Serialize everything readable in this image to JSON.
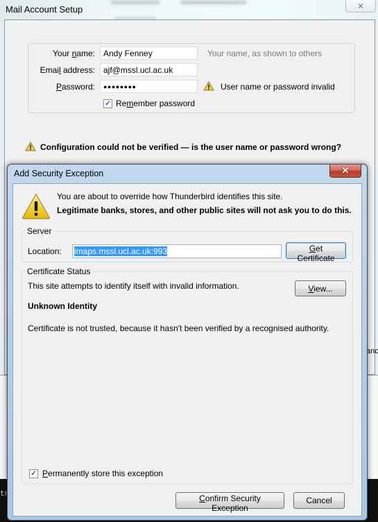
{
  "background": {
    "right_fragment_text": "anc",
    "terminal_fragment_text": "tn"
  },
  "mail_setup": {
    "window_title": "Mail Account Setup",
    "close_glyph": "✕",
    "fields": {
      "name": {
        "label_pre": "Your ",
        "label_accel": "n",
        "label_post": "ame:",
        "value": "Andy Fenney",
        "hint": "Your name, as shown to others"
      },
      "email": {
        "label_pre": "Emai",
        "label_accel": "l",
        "label_post": " address:",
        "value": "ajf@mssl.ucl.ac.uk"
      },
      "password": {
        "label_pre": "",
        "label_accel": "P",
        "label_post": "assword:",
        "value": "●●●●●●●●",
        "error": "User name or password invalid"
      }
    },
    "remember_password": {
      "label_pre": "Re",
      "label_accel": "m",
      "label_post": "ember password",
      "checked": true,
      "check_glyph": "✓"
    },
    "config_message": "Configuration could not be verified — is the user name or password wrong?"
  },
  "security_exception": {
    "title": "Add Security Exception",
    "close_glyph": "✕",
    "warning_line1": "You are about to override how Thunderbird identifies this site.",
    "warning_line2": "Legitimate banks, stores, and other public sites will not ask you to do this.",
    "server": {
      "legend": "Server",
      "location_label": "Location:",
      "location_value": "imaps.mssl.ucl.ac.uk:993",
      "get_certificate": {
        "accel": "G",
        "rest": "et Certificate"
      }
    },
    "certificate_status": {
      "legend": "Certificate Status",
      "summary": "This site attempts to identify itself with invalid information.",
      "view_button": {
        "accel": "V",
        "rest": "iew..."
      },
      "heading": "Unknown Identity",
      "detail": "Certificate is not trusted, because it hasn't been verified by a recognised authority."
    },
    "permanent_store": {
      "accel": "P",
      "rest": "ermanently store this exception",
      "checked": true,
      "check_glyph": "✓"
    },
    "confirm_button": {
      "accel": "C",
      "rest": "onfirm Security Exception"
    },
    "cancel_button": "Cancel"
  }
}
